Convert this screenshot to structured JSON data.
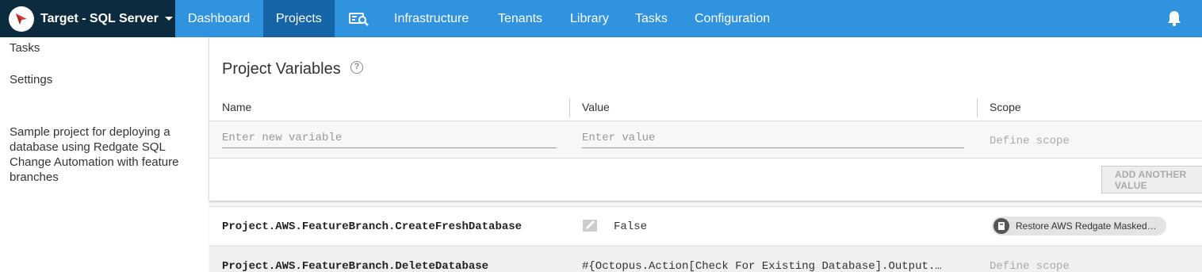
{
  "topbar": {
    "space_name": "Target - SQL Server",
    "nav": [
      "Dashboard",
      "Projects",
      "Infrastructure",
      "Tenants",
      "Library",
      "Tasks",
      "Configuration"
    ],
    "active": "Projects"
  },
  "sidebar": {
    "links": [
      "Tasks",
      "Settings"
    ],
    "description": "Sample project for deploying a database using Redgate SQL Change Automation with feature branches"
  },
  "main": {
    "title": "Project Variables",
    "columns": {
      "name": "Name",
      "value": "Value",
      "scope": "Scope"
    },
    "new_variable": {
      "name_placeholder": "Enter new variable",
      "value_placeholder": "Enter value",
      "scope_placeholder": "Define scope"
    },
    "add_button": "ADD ANOTHER VALUE",
    "variables": [
      {
        "name": "Project.AWS.FeatureBranch.CreateFreshDatabase",
        "value": "False",
        "scope": "Restore AWS Redgate Masked…"
      },
      {
        "name": "Project.AWS.FeatureBranch.DeleteDatabase",
        "value": "#{Octopus.Action[Check For Existing Database].Output.…",
        "scope": "Define scope"
      }
    ]
  },
  "colors": {
    "topbar": "#2f93e0",
    "space_switcher": "#0d2b3e",
    "active_nav": "#1565a8"
  }
}
